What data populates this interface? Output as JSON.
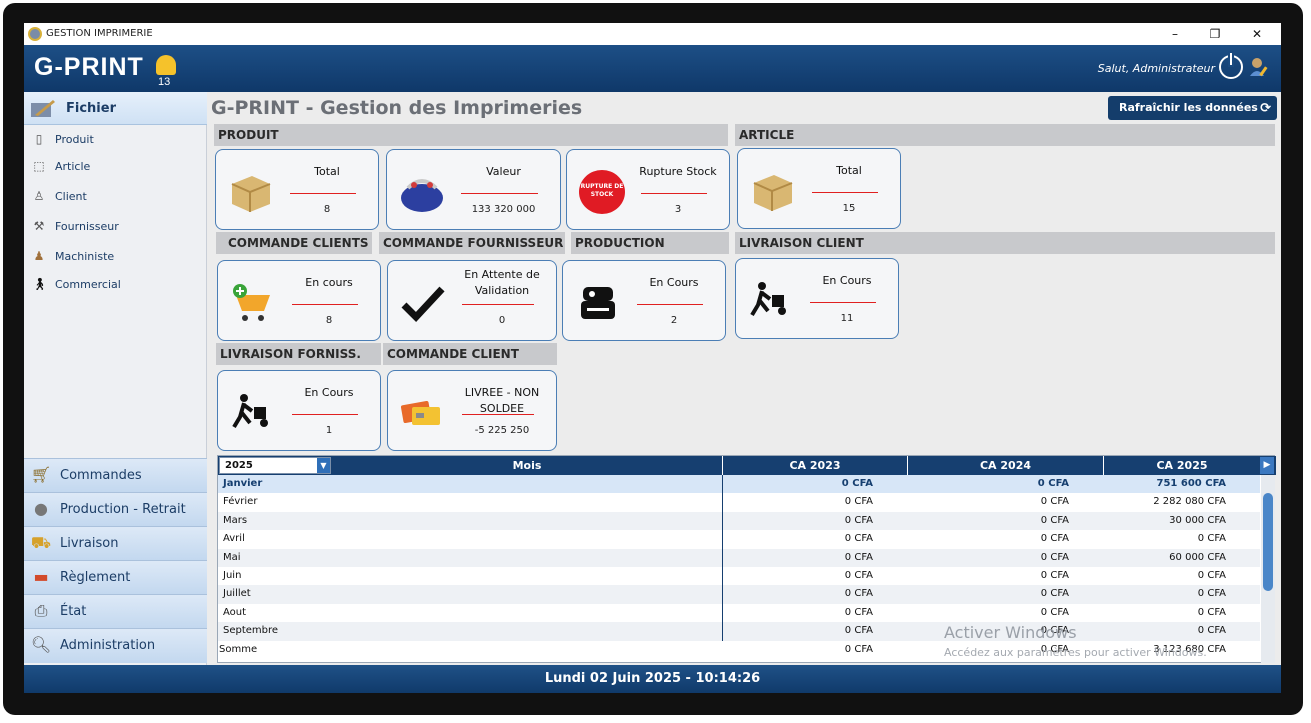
{
  "window": {
    "title": "GESTION IMPRIMERIE",
    "minimize": "–",
    "maximize": "❐",
    "close": "✕"
  },
  "header": {
    "logo": "G-PRINT",
    "version": "13",
    "greeting": "Salut, Administrateur"
  },
  "sidebar": {
    "head": "Fichier",
    "items": [
      {
        "label": "Produit",
        "icon": "product-icon"
      },
      {
        "label": "Article",
        "icon": "article-icon"
      },
      {
        "label": "Client",
        "icon": "client-icon"
      },
      {
        "label": "Fournisseur",
        "icon": "supplier-icon"
      },
      {
        "label": "Machiniste",
        "icon": "machinist-icon"
      },
      {
        "label": "Commercial",
        "icon": "commercial-icon"
      }
    ],
    "sections": [
      {
        "label": "Commandes",
        "icon": "cart-icon"
      },
      {
        "label": "Production - Retrait",
        "icon": "disc-icon"
      },
      {
        "label": "Livraison",
        "icon": "delivery-icon"
      },
      {
        "label": "Règlement",
        "icon": "payment-icon"
      },
      {
        "label": "État",
        "icon": "printer-icon"
      },
      {
        "label": "Administration",
        "icon": "admin-icon"
      }
    ]
  },
  "main": {
    "title": "G-PRINT - Gestion des Imprimeries",
    "refresh_label": "Rafraîchir les données",
    "sections": {
      "produit": "PRODUIT",
      "article": "ARTICLE",
      "commande_clients": "COMMANDE CLIENTS",
      "commande_fournisseur": "COMMANDE FOURNISSEUR",
      "production": "PRODUCTION",
      "livraison_client": "LIVRAISON CLIENT",
      "livraison_forniss": "LIVRAISON FORNISS.",
      "commande_client": "COMMANDE CLIENT"
    },
    "cards": {
      "produit_total": {
        "label": "Total",
        "value": "8"
      },
      "produit_valeur": {
        "label": "Valeur",
        "value": "133 320 000"
      },
      "produit_rupture": {
        "label": "Rupture Stock",
        "value": "3",
        "badge": "RUPTURE DE STOCK"
      },
      "article_total": {
        "label": "Total",
        "value": "15"
      },
      "cmdcli_encours": {
        "label": "En cours",
        "value": "8"
      },
      "cmdfour_attente": {
        "label": "En Attente de Validation",
        "value": "0"
      },
      "production_encours": {
        "label": "En Cours",
        "value": "2"
      },
      "livcli_encours": {
        "label": "En Cours",
        "value": "11"
      },
      "livfour_encours": {
        "label": "En Cours",
        "value": "1"
      },
      "cmdcli_livree": {
        "label": "LIVREE - NON SOLDEE",
        "value": "-5 225 250"
      }
    },
    "grid": {
      "year": "2025",
      "headers": [
        "Mois",
        "CA 2023",
        "CA 2024",
        "CA 2025"
      ],
      "rows": [
        {
          "mois": "Janvier",
          "ca2023": "0 CFA",
          "ca2024": "0 CFA",
          "ca2025": "751 600 CFA"
        },
        {
          "mois": "Février",
          "ca2023": "0 CFA",
          "ca2024": "0 CFA",
          "ca2025": "2 282 080 CFA"
        },
        {
          "mois": "Mars",
          "ca2023": "0 CFA",
          "ca2024": "0 CFA",
          "ca2025": "30 000 CFA"
        },
        {
          "mois": "Avril",
          "ca2023": "0 CFA",
          "ca2024": "0 CFA",
          "ca2025": "0 CFA"
        },
        {
          "mois": "Mai",
          "ca2023": "0 CFA",
          "ca2024": "0 CFA",
          "ca2025": "60 000 CFA"
        },
        {
          "mois": "Juin",
          "ca2023": "0 CFA",
          "ca2024": "0 CFA",
          "ca2025": "0 CFA"
        },
        {
          "mois": "Juillet",
          "ca2023": "0 CFA",
          "ca2024": "0 CFA",
          "ca2025": "0 CFA"
        },
        {
          "mois": "Aout",
          "ca2023": "0 CFA",
          "ca2024": "0 CFA",
          "ca2025": "0 CFA"
        },
        {
          "mois": "Septembre",
          "ca2023": "0 CFA",
          "ca2024": "0 CFA",
          "ca2025": "0 CFA"
        },
        {
          "mois": "Somme",
          "ca2023": "0 CFA",
          "ca2024": "0 CFA",
          "ca2025": "3 123 680 CFA"
        }
      ]
    }
  },
  "watermark": {
    "line1": "Activer Windows",
    "line2": "Accédez aux paramètres pour activer Windows."
  },
  "status": {
    "datetime": "Lundi 02 Juin 2025 - 10:14:26"
  }
}
